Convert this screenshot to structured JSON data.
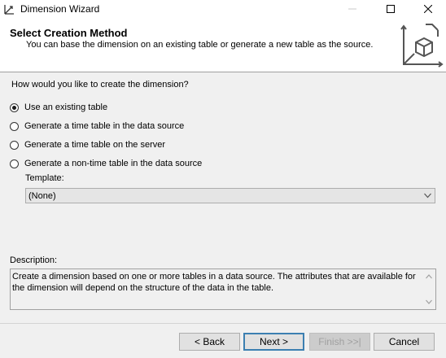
{
  "window": {
    "title": "Dimension Wizard"
  },
  "header": {
    "title": "Select Creation Method",
    "subtitle": "You can base the dimension on an existing table or generate a new table as the source."
  },
  "question": "How would you like to create the dimension?",
  "options": [
    {
      "label": "Use an existing table",
      "selected": true
    },
    {
      "label": "Generate a time table in the data source",
      "selected": false
    },
    {
      "label": "Generate a time table on the server",
      "selected": false
    },
    {
      "label": "Generate a non-time table in the data source",
      "selected": false
    }
  ],
  "template": {
    "label": "Template:",
    "value": "(None)"
  },
  "description": {
    "label": "Description:",
    "text": "Create a dimension based on one or more tables in a data source. The attributes that are available for the dimension will depend on the structure of the data in the table."
  },
  "buttons": {
    "back": "< Back",
    "next": "Next >",
    "finish": "Finish >>|",
    "cancel": "Cancel"
  }
}
